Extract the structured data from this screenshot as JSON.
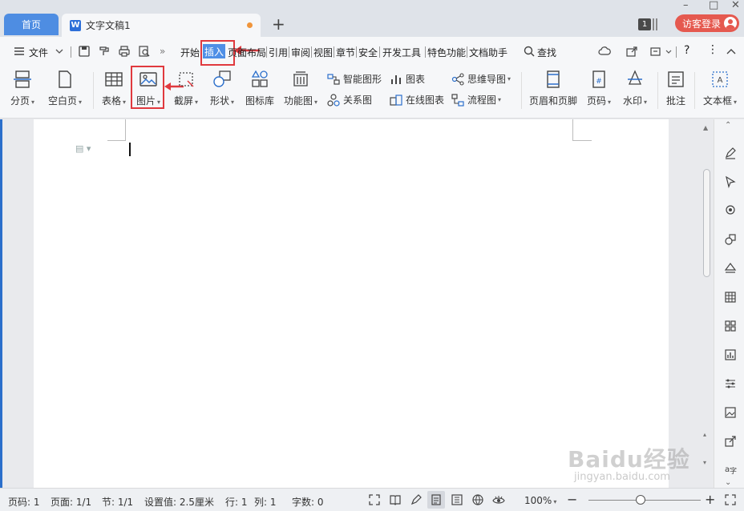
{
  "tabs": {
    "home": "首页",
    "doc_title": "文字文稿1",
    "window_count": "1",
    "login": "访客登录"
  },
  "window_controls": {
    "minimize": "–",
    "maximize": "□",
    "close": "✕"
  },
  "menubar": {
    "file": "文件",
    "items": [
      "开始",
      "插入",
      "页面布局",
      "引用",
      "审阅",
      "视图",
      "章节",
      "安全",
      "开发工具",
      "特色功能",
      "文档助手"
    ],
    "search": "查找",
    "help": "?"
  },
  "ribbon": {
    "page_break": "分页",
    "blank_page": "空白页",
    "table": "表格",
    "picture": "图片",
    "screenshot": "截屏",
    "shapes": "形状",
    "icon_lib": "图标库",
    "function_chart": "功能图",
    "smart_art": "智能图形",
    "chart": "图表",
    "mind_map": "思维导图",
    "relation": "关系图",
    "online_chart": "在线图表",
    "flowchart": "流程图",
    "header_footer": "页眉和页脚",
    "page_number": "页码",
    "watermark": "水印",
    "comment": "批注",
    "textbox": "文本框"
  },
  "status": {
    "page_num": "页码: 1",
    "pages": "页面: 1/1",
    "section": "节: 1/1",
    "setting": "设置值: 2.5厘米",
    "row": "行: 1",
    "col": "列: 1",
    "words": "字数: 0",
    "zoom": "100%"
  },
  "watermark": {
    "brand": "Baidu经验",
    "url": "jingyan.baidu.com"
  },
  "colors": {
    "accent": "#4f8fe6",
    "highlight": "#e0393e",
    "login": "#e5594f"
  }
}
